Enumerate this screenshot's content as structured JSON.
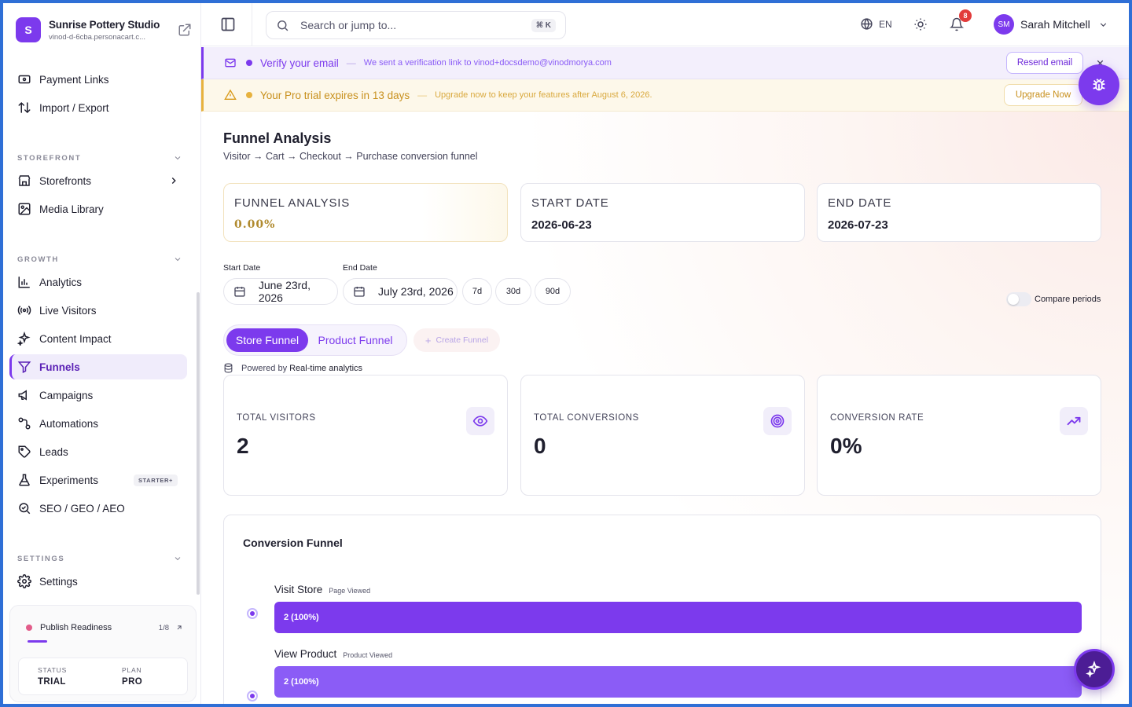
{
  "brand": {
    "initial": "S",
    "name": "Sunrise Pottery Studio",
    "subdomain": "vinod-d-6cba.personacart.c..."
  },
  "sidebar": {
    "top_items": [
      {
        "label": "Payment Links",
        "icon": "payment-links-icon"
      },
      {
        "label": "Import / Export",
        "icon": "import-export-icon"
      }
    ],
    "sections": {
      "storefront": "STOREFRONT",
      "growth": "GROWTH",
      "settings": "SETTINGS"
    },
    "storefront_items": [
      {
        "label": "Storefronts",
        "icon": "storefront-icon"
      },
      {
        "label": "Media Library",
        "icon": "image-icon"
      }
    ],
    "growth_items": [
      {
        "label": "Analytics",
        "icon": "bar-chart-icon"
      },
      {
        "label": "Live Visitors",
        "icon": "broadcast-icon"
      },
      {
        "label": "Content Impact",
        "icon": "sparkle-icon"
      },
      {
        "label": "Funnels",
        "icon": "filter-icon",
        "active": true
      },
      {
        "label": "Campaigns",
        "icon": "megaphone-icon"
      },
      {
        "label": "Automations",
        "icon": "workflow-icon"
      },
      {
        "label": "Leads",
        "icon": "tag-icon"
      },
      {
        "label": "Experiments",
        "icon": "flask-icon",
        "badge": "STARTER+"
      },
      {
        "label": "SEO / GEO / AEO",
        "icon": "search-check-icon"
      }
    ],
    "settings_items": [
      {
        "label": "Settings",
        "icon": "gear-icon"
      }
    ],
    "publish": {
      "label": "Publish Readiness",
      "count": "1/8",
      "progress": 0.125
    },
    "status": {
      "status_label": "STATUS",
      "status_value": "TRIAL",
      "plan_label": "PLAN",
      "plan_value": "PRO"
    }
  },
  "topbar": {
    "search_placeholder": "Search or jump to...",
    "search_shortcut": "⌘ K",
    "language": "EN",
    "notifications_count": "8",
    "user_initials": "SM",
    "user_name": "Sarah Mitchell"
  },
  "banners": {
    "verify": {
      "title": "Verify your email",
      "dash": "—",
      "message": "We sent a verification link to vinod+docsdemo@vinodmorya.com",
      "button": "Resend email"
    },
    "trial": {
      "title": "Your Pro trial expires in 13 days",
      "dash": "—",
      "message": "Upgrade now to keep your features after August 6, 2026.",
      "button": "Upgrade Now"
    }
  },
  "page": {
    "title": "Funnel Analysis",
    "subtitle": "Visitor → Cart → Checkout → Purchase conversion funnel"
  },
  "summary_cards": [
    {
      "label": "FUNNEL ANALYSIS",
      "value": "0.00%"
    },
    {
      "label": "START DATE",
      "value": "2026-06-23"
    },
    {
      "label": "END DATE",
      "value": "2026-07-23"
    }
  ],
  "filters": {
    "start_label": "Start Date",
    "start_value": "June 23rd, 2026",
    "end_label": "End Date",
    "end_value": "July 23rd, 2026",
    "ranges": [
      "7d",
      "30d",
      "90d"
    ],
    "compare_label": "Compare periods"
  },
  "tabs": {
    "active": "Store Funnel",
    "inactive": "Product Funnel",
    "create": "Create Funnel"
  },
  "powered": {
    "prefix": "Powered by",
    "source": "Real-time analytics"
  },
  "kpis": [
    {
      "label": "TOTAL VISITORS",
      "value": "2",
      "icon": "eye-icon"
    },
    {
      "label": "TOTAL CONVERSIONS",
      "value": "0",
      "icon": "target-icon"
    },
    {
      "label": "CONVERSION RATE",
      "value": "0%",
      "icon": "trending-up-icon"
    }
  ],
  "funnel": {
    "title": "Conversion Funnel",
    "steps": [
      {
        "name": "Visit Store",
        "event": "Page Viewed",
        "value_label": "2 (100%)",
        "percent": 100,
        "color": "#7c3aed"
      },
      {
        "name": "View Product",
        "event": "Product Viewed",
        "value_label": "2 (100%)",
        "percent": 100,
        "color": "#8b5cf6"
      }
    ]
  },
  "colors": {
    "accent": "#7c3aed",
    "warning": "#e7b23e",
    "danger": "#e23b3b"
  }
}
